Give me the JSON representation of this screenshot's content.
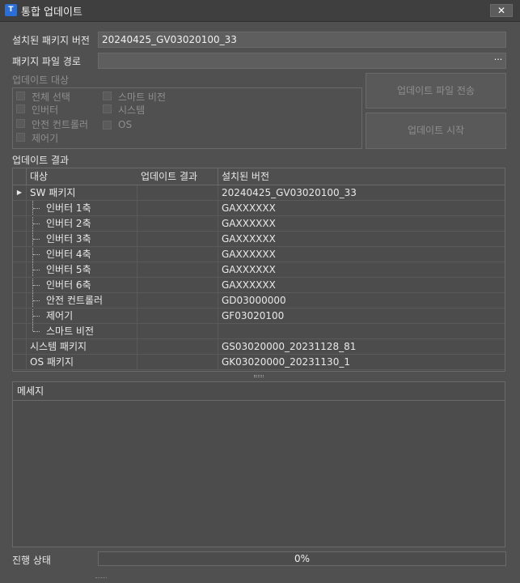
{
  "window": {
    "title": "통합 업데이트",
    "icon_letter": "T",
    "close_glyph": "✕"
  },
  "installed_version": {
    "label": "설치된 패키지 버전",
    "value": "20240425_GV03020100_33"
  },
  "package_path": {
    "label": "패키지 파일 경로",
    "value": "",
    "browse_label": "···"
  },
  "targets": {
    "label": "업데이트 대상",
    "checkboxes": [
      {
        "label": "전체 선택",
        "checked": false
      },
      {
        "label": "인버터",
        "checked": false
      },
      {
        "label": "안전 컨트롤러",
        "checked": false
      },
      {
        "label": "제어기",
        "checked": false
      },
      {
        "label": "스마트 비전",
        "checked": false
      },
      {
        "label": "시스템",
        "checked": false
      },
      {
        "label": "OS",
        "checked": false
      }
    ]
  },
  "buttons": {
    "send_file": "업데이트 파일 전송",
    "start_update": "업데이트 시작"
  },
  "results": {
    "label": "업데이트 결과",
    "columns": [
      "대상",
      "업데이트 결과",
      "설치된 버전"
    ],
    "rows": [
      {
        "target": "SW 패키지",
        "result": "",
        "version": "20240425_GV03020100_33",
        "indent": 0,
        "marker": "▶"
      },
      {
        "target": "인버터 1축",
        "result": "",
        "version": "GAXXXXXX",
        "indent": 1
      },
      {
        "target": "인버터 2축",
        "result": "",
        "version": "GAXXXXXX",
        "indent": 1
      },
      {
        "target": "인버터 3축",
        "result": "",
        "version": "GAXXXXXX",
        "indent": 1
      },
      {
        "target": "인버터 4축",
        "result": "",
        "version": "GAXXXXXX",
        "indent": 1
      },
      {
        "target": "인버터 5축",
        "result": "",
        "version": "GAXXXXXX",
        "indent": 1
      },
      {
        "target": "인버터 6축",
        "result": "",
        "version": "GAXXXXXX",
        "indent": 1
      },
      {
        "target": "안전 컨트롤러",
        "result": "",
        "version": "GD03000000",
        "indent": 1
      },
      {
        "target": "제어기",
        "result": "",
        "version": "GF03020100",
        "indent": 1
      },
      {
        "target": "스마트 비전",
        "result": "",
        "version": "",
        "indent": 1
      },
      {
        "target": "시스템 패키지",
        "result": "",
        "version": "GS03020000_20231128_81",
        "indent": 0
      },
      {
        "target": "OS 패키지",
        "result": "",
        "version": "GK03020000_20231130_1",
        "indent": 0
      }
    ]
  },
  "messages": {
    "label": "메세지"
  },
  "progress": {
    "label": "진행 상태",
    "value_text": "0%",
    "fraction": 0
  }
}
